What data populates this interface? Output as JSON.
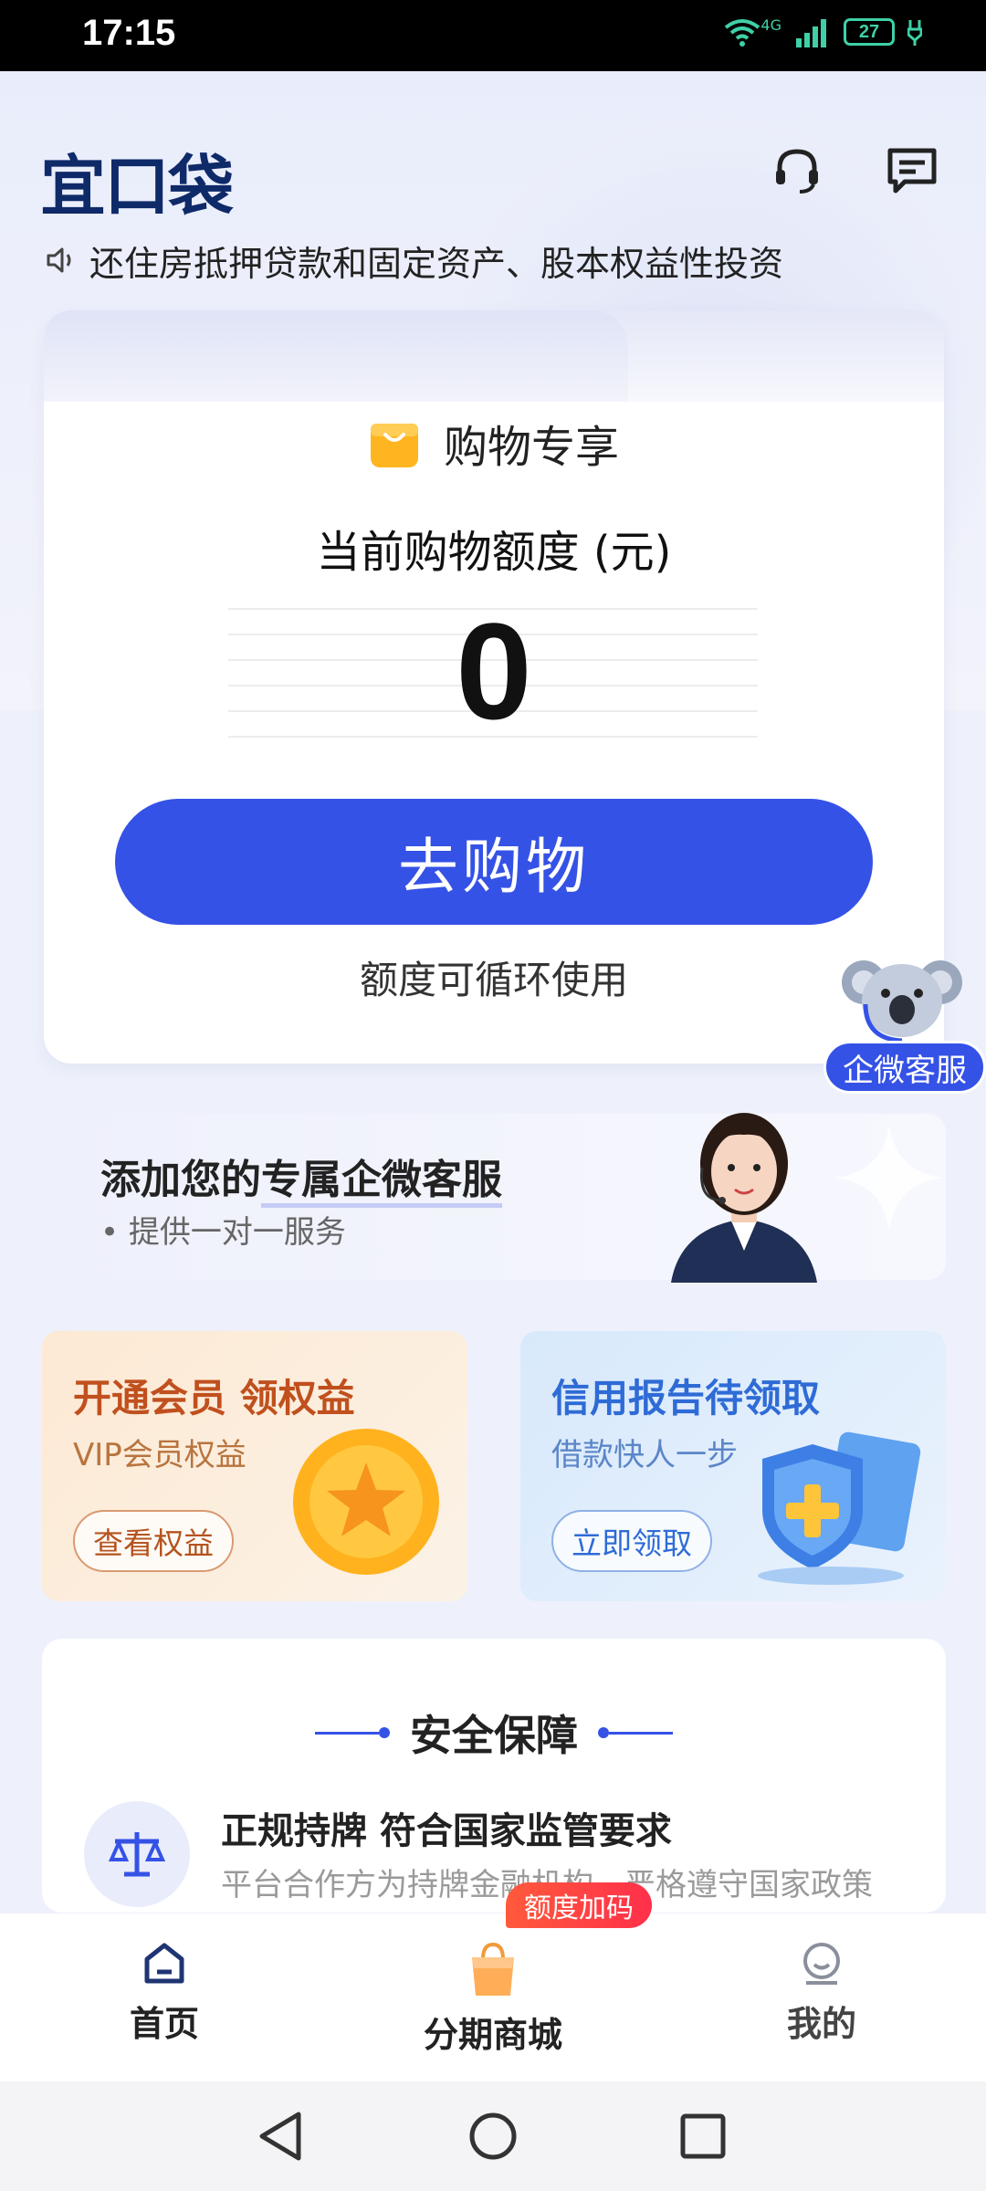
{
  "status_bar": {
    "time": "17:15",
    "battery": "27",
    "network": "4G"
  },
  "header": {
    "logo": "宜口袋"
  },
  "notice": {
    "text": "还住房抵押贷款和固定资产、股本权益性投资"
  },
  "card": {
    "shop_label": "购物专享",
    "quota_label": "当前购物额度 (元)",
    "quota_value": "0",
    "button_label": "去购物",
    "note": "额度可循环使用"
  },
  "float_service": {
    "label": "企微客服"
  },
  "wecom_banner": {
    "title_prefix": "添加您的",
    "title_highlight": "专属企微客服",
    "subtitle": "提供一对一服务"
  },
  "promos": [
    {
      "title": "开通会员 领权益",
      "subtitle": "VIP会员权益",
      "button": "查看权益"
    },
    {
      "title": "信用报告待领取",
      "subtitle": "借款快人一步",
      "button": "立即领取"
    }
  ],
  "security": {
    "title": "安全保障",
    "item_title": "正规持牌 符合国家监管要求",
    "item_subtitle": "平台合作方为持牌金融机构，严格遵守国家政策"
  },
  "tabbar": {
    "badge": "额度加码",
    "tabs": [
      {
        "label": "首页"
      },
      {
        "label": "分期商城"
      },
      {
        "label": "我的"
      }
    ]
  },
  "colors": {
    "accent": "#3552e6",
    "logo": "#0f2a68",
    "vip": "#c0501e",
    "credit": "#2e6bd6"
  }
}
